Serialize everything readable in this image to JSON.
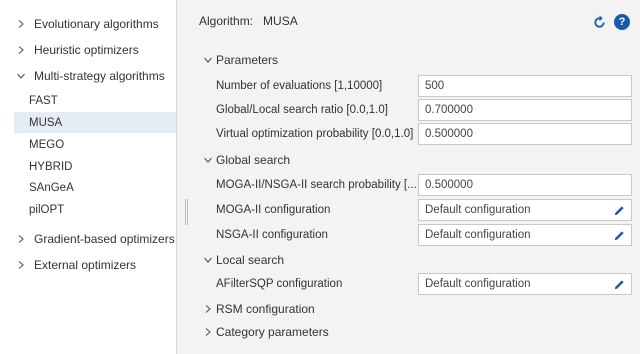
{
  "sidebar": {
    "groups": [
      {
        "label": "Evolutionary algorithms"
      },
      {
        "label": "Heuristic optimizers"
      },
      {
        "label": "Multi-strategy algorithms"
      },
      {
        "label": "Gradient-based optimizers"
      },
      {
        "label": "External optimizers"
      }
    ],
    "items": [
      {
        "label": "FAST"
      },
      {
        "label": "MUSA"
      },
      {
        "label": "MEGO"
      },
      {
        "label": "HYBRID"
      },
      {
        "label": "SAnGeA"
      },
      {
        "label": "pilOPT"
      }
    ],
    "selected": "MUSA"
  },
  "header": {
    "algorithm_label": "Algorithm:",
    "algorithm_value": "MUSA",
    "reset_icon": "reset-icon",
    "help_icon": "help-icon",
    "help_glyph": "?"
  },
  "sections": {
    "parameters": "Parameters",
    "global_search": "Global search",
    "local_search": "Local search",
    "rsm": "RSM configuration",
    "category": "Category parameters"
  },
  "params": {
    "evaluations": {
      "label": "Number of evaluations [1,10000]",
      "value": "500"
    },
    "ratio": {
      "label": "Global/Local search ratio [0.0,1.0]",
      "value": "0.700000"
    },
    "virtual": {
      "label": "Virtual optimization probability [0.0,1.0]",
      "value": "0.500000"
    }
  },
  "global": {
    "probability": {
      "label": "MOGA-II/NSGA-II search probability [...",
      "value": "0.500000"
    },
    "moga": {
      "label": "MOGA-II configuration",
      "value": "Default configuration"
    },
    "nsga": {
      "label": "NSGA-II configuration",
      "value": "Default configuration"
    }
  },
  "local": {
    "afilter": {
      "label": "AFilterSQP configuration",
      "value": "Default configuration"
    }
  },
  "colors": {
    "accent": "#1a5aa8",
    "selected_bg": "#e5ecf6"
  }
}
